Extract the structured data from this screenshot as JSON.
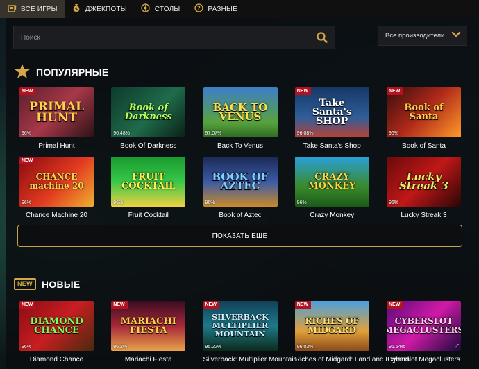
{
  "nav": {
    "tabs": [
      {
        "label": "ВСЕ ИГРЫ",
        "icon": "slot-machine-icon"
      },
      {
        "label": "ДЖЕКПОТЫ",
        "icon": "money-bag-icon"
      },
      {
        "label": "СТОЛЫ",
        "icon": "roulette-icon"
      },
      {
        "label": "РАЗНЫЕ",
        "icon": "question-icon"
      }
    ],
    "active_index": 0
  },
  "search": {
    "placeholder": "Поиск",
    "value": ""
  },
  "provider": {
    "label": "Все производители"
  },
  "popular": {
    "title": "ПОПУЛЯРНЫЕ",
    "games": [
      {
        "name": "Primal Hunt",
        "art": "PRIMAL HUNT",
        "rtp": "96%",
        "badge": "NEW"
      },
      {
        "name": "Book Of Darkness",
        "art": "Book of Darkness",
        "rtp": "96.48%",
        "badge": ""
      },
      {
        "name": "Back To Venus",
        "art": "BACK TO VENUS",
        "rtp": "97.07%",
        "badge": ""
      },
      {
        "name": "Take Santa's Shop",
        "art": "Take Santa's SHOP",
        "rtp": "96.08%",
        "badge": "NEW"
      },
      {
        "name": "Book of Santa",
        "art": "Book of Santa",
        "rtp": "96%",
        "badge": "NEW"
      },
      {
        "name": "Chance Machine 20",
        "art": "CHANCE machine 20",
        "rtp": "96%",
        "badge": "NEW"
      },
      {
        "name": "Fruit Cocktail",
        "art": "FRUIT COCKTAIL",
        "rtp": "96%",
        "badge": ""
      },
      {
        "name": "Book of Aztec",
        "art": "BOOK OF AZTEC",
        "rtp": "96%",
        "badge": ""
      },
      {
        "name": "Crazy Monkey",
        "art": "CRAZY MONKEY",
        "rtp": "96%",
        "badge": ""
      },
      {
        "name": "Lucky Streak 3",
        "art": "Lucky Streak 3",
        "rtp": "96%",
        "badge": ""
      }
    ],
    "show_more": "ПОКАЗАТЬ ЕЩЕ"
  },
  "new_section": {
    "badge": "NEW",
    "title": "НОВЫЕ",
    "games": [
      {
        "name": "Diamond Chance",
        "art": "DIAMOND CHANCE",
        "rtp": "96%",
        "badge": "NEW"
      },
      {
        "name": "Mariachi Fiesta",
        "art": "MARIACHI FIESTA",
        "rtp": "96.2%",
        "badge": "NEW"
      },
      {
        "name": "Silverback: Multiplier Mountain",
        "art": "SILVERBACK MULTIPLIER MOUNTAIN",
        "rtp": "95.22%",
        "badge": "NEW"
      },
      {
        "name": "Riches of Midgard: Land and Expand",
        "art": "RICHES OF MIDGARD",
        "rtp": "96.03%",
        "badge": "NEW"
      },
      {
        "name": "Cyberslot Megaclusters",
        "art": "CYBERSLOT MEGACLUSTERS",
        "rtp": "96.54%",
        "badge": "NEW"
      }
    ]
  },
  "colors": {
    "accent": "#d4a84a",
    "new_badge": "#b4121f",
    "panel": "#0a0d10"
  }
}
